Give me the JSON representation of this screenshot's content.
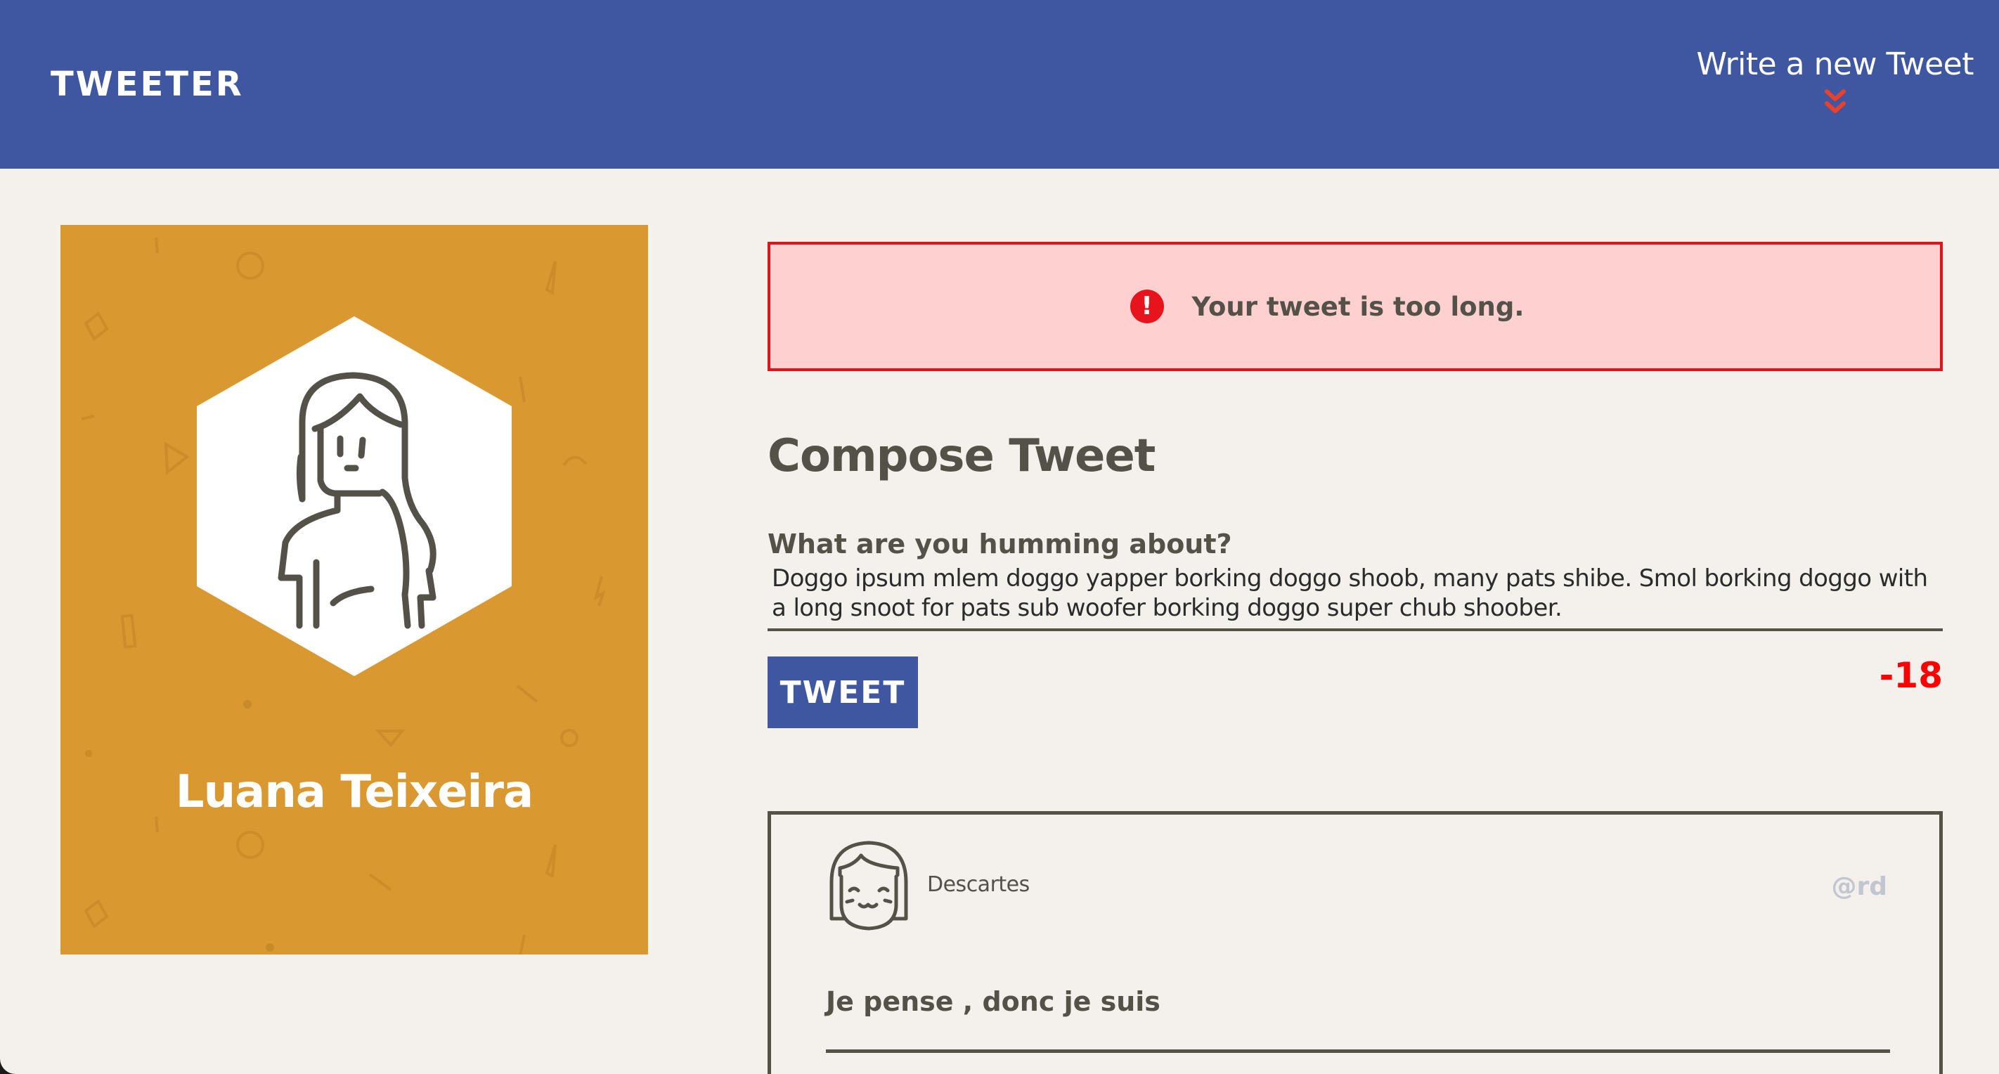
{
  "header": {
    "logo": "TWEETER",
    "compose_toggle": "Write a new Tweet",
    "toggle_icon": "double-chevron-down-icon"
  },
  "colors": {
    "navbar": "#3f56a0",
    "profile_card": "#da9830",
    "alert_background": "#ffd0d0",
    "alert_border": "#e0141c",
    "counter_error": "#ff0000",
    "page_background": "#f4f1ec",
    "text": "#545149"
  },
  "profile": {
    "name": "Luana Teixeira",
    "avatar_icon": "woman-avatar-icon"
  },
  "alert": {
    "icon": "exclamation-circle-icon",
    "message": "Your tweet is too long."
  },
  "compose": {
    "title": "Compose Tweet",
    "label": "What are you humming about?",
    "text_value": "Doggo ipsum mlem doggo yapper borking doggo shoob, many pats shibe. Smol borking doggo with a long snoot for pats sub woofer borking doggo super chub shoober.",
    "button_label": "TWEET",
    "counter": "-18"
  },
  "tweets": [
    {
      "author": "Descartes",
      "handle": "@rd",
      "content": "Je pense , donc je suis",
      "avatar_icon": "smiling-girl-avatar-icon"
    }
  ]
}
